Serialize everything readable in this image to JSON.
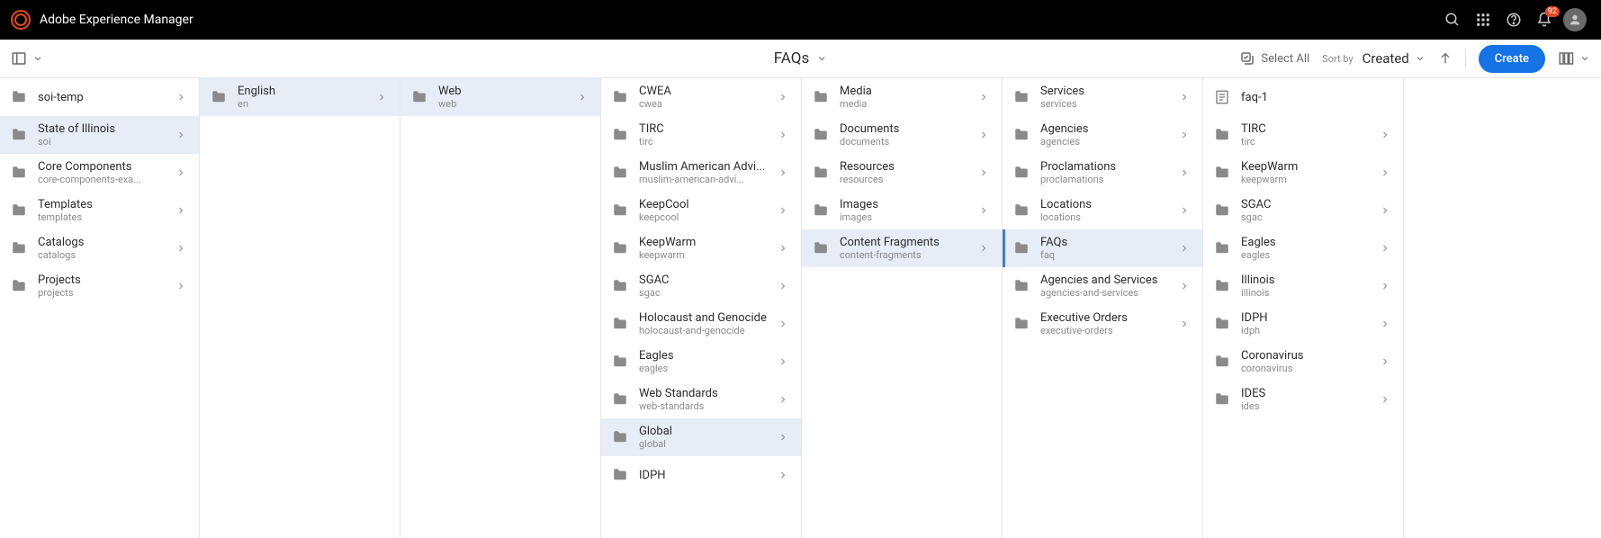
{
  "header": {
    "product": "Adobe Experience Manager",
    "notif_count": "92"
  },
  "toolbar": {
    "breadcrumb_title": "FAQs",
    "select_all_label": "Select All",
    "sort_by_label": "Sort by",
    "sort_field": "Created",
    "create_label": "Create"
  },
  "columns": [
    {
      "items": [
        {
          "title": "soi-temp",
          "sub": ""
        },
        {
          "title": "State of Illinois",
          "sub": "soi",
          "state": "selected"
        },
        {
          "title": "Core Components",
          "sub": "core-components-exa..."
        },
        {
          "title": "Templates",
          "sub": "templates"
        },
        {
          "title": "Catalogs",
          "sub": "catalogs"
        },
        {
          "title": "Projects",
          "sub": "projects"
        }
      ]
    },
    {
      "items": [
        {
          "title": "English",
          "sub": "en",
          "state": "selected"
        }
      ]
    },
    {
      "items": [
        {
          "title": "Web",
          "sub": "web",
          "state": "selected"
        }
      ]
    },
    {
      "items": [
        {
          "title": "CWEA",
          "sub": "cwea"
        },
        {
          "title": "TIRC",
          "sub": "tirc"
        },
        {
          "title": "Muslim American Advi...",
          "sub": "muslim-american-advi..."
        },
        {
          "title": "KeepCool",
          "sub": "keepcool"
        },
        {
          "title": "KeepWarm",
          "sub": "keepwarm"
        },
        {
          "title": "SGAC",
          "sub": "sgac"
        },
        {
          "title": "Holocaust and Genocide",
          "sub": "holocaust-and-genocide"
        },
        {
          "title": "Eagles",
          "sub": "eagles"
        },
        {
          "title": "Web Standards",
          "sub": "web-standards"
        },
        {
          "title": "Global",
          "sub": "global",
          "state": "selected"
        },
        {
          "title": "IDPH",
          "sub": ""
        }
      ]
    },
    {
      "items": [
        {
          "title": "Media",
          "sub": "media"
        },
        {
          "title": "Documents",
          "sub": "documents"
        },
        {
          "title": "Resources",
          "sub": "resources"
        },
        {
          "title": "Images",
          "sub": "images"
        },
        {
          "title": "Content Fragments",
          "sub": "content-fragments",
          "state": "selected"
        }
      ]
    },
    {
      "items": [
        {
          "title": "Services",
          "sub": "services"
        },
        {
          "title": "Agencies",
          "sub": "agencies"
        },
        {
          "title": "Proclamations",
          "sub": "proclamations"
        },
        {
          "title": "Locations",
          "sub": "locations"
        },
        {
          "title": "FAQs",
          "sub": "faq",
          "state": "active"
        },
        {
          "title": "Agencies and Services",
          "sub": "agencies-and-services"
        },
        {
          "title": "Executive Orders",
          "sub": "executive-orders"
        }
      ]
    },
    {
      "items": [
        {
          "title": "faq-1",
          "sub": "",
          "icon": "fragment",
          "nochev": true
        },
        {
          "title": "TIRC",
          "sub": "tirc"
        },
        {
          "title": "KeepWarm",
          "sub": "keepwarm"
        },
        {
          "title": "SGAC",
          "sub": "sgac"
        },
        {
          "title": "Eagles",
          "sub": "eagles"
        },
        {
          "title": "Illinois",
          "sub": "illinois"
        },
        {
          "title": "IDPH",
          "sub": "idph"
        },
        {
          "title": "Coronavirus",
          "sub": "coronavirus"
        },
        {
          "title": "IDES",
          "sub": "ides"
        }
      ]
    }
  ]
}
